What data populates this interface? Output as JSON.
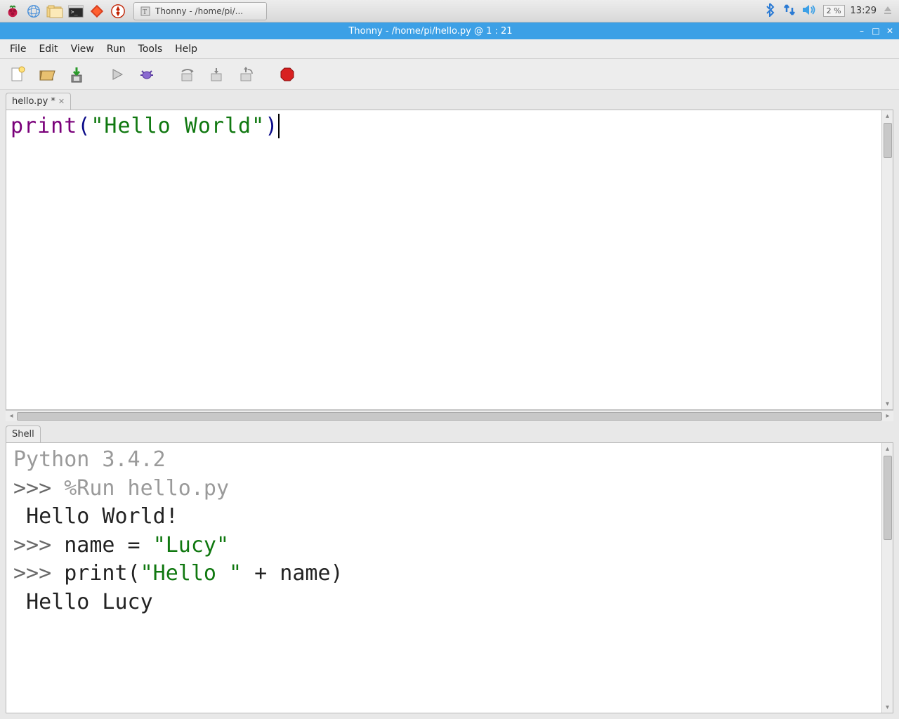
{
  "taskbar": {
    "app_label": "Thonny  -  /home/pi/...",
    "cpu": "2 %",
    "clock": "13:29"
  },
  "window": {
    "title": "Thonny  -  /home/pi/hello.py  @  1 : 21"
  },
  "menu": {
    "file": "File",
    "edit": "Edit",
    "view": "View",
    "run": "Run",
    "tools": "Tools",
    "help": "Help"
  },
  "editor": {
    "tab_label": "hello.py *",
    "code": {
      "func": "print",
      "lparen": "(",
      "string": "\"Hello World\"",
      "rparen": ")"
    }
  },
  "shell": {
    "tab_label": "Shell",
    "header": "Python 3.4.2",
    "prompt": ">>>",
    "run_cmd": "%Run hello.py",
    "out1": "Hello World!",
    "line2_a": "name = ",
    "line2_b": "\"Lucy\"",
    "line3_a": "print(",
    "line3_b": "\"Hello \"",
    "line3_c": " + name)",
    "out2": "Hello Lucy"
  }
}
